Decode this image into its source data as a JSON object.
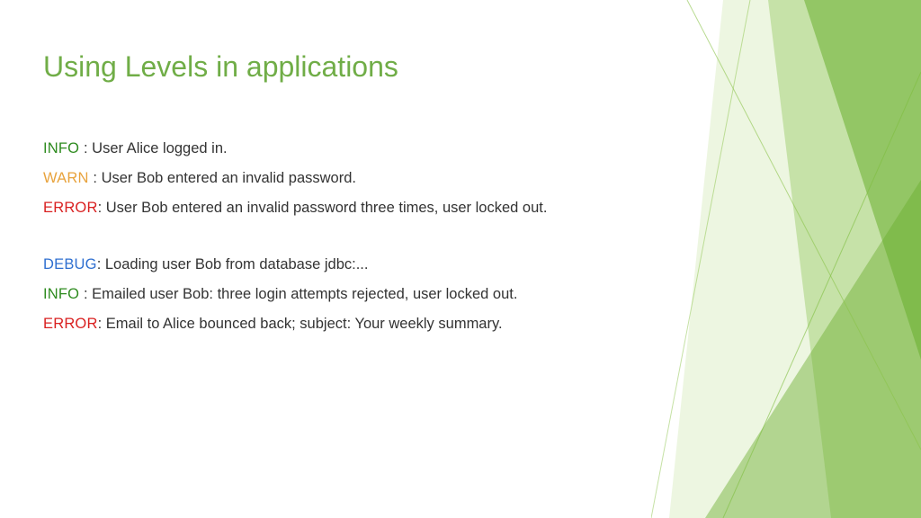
{
  "title": "Using Levels in applications",
  "logs": {
    "group1": [
      {
        "level": "INFO",
        "levelPadded": "INFO ",
        "sep": ": ",
        "msg": "User Alice logged in."
      },
      {
        "level": "WARN",
        "levelPadded": "WARN ",
        "sep": ": ",
        "msg": "User Bob entered an invalid password."
      },
      {
        "level": "ERROR",
        "levelPadded": "ERROR",
        "sep": ": ",
        "msg": "User Bob entered an invalid password three times, user locked out."
      }
    ],
    "group2": [
      {
        "level": "DEBUG",
        "levelPadded": "DEBUG",
        "sep": ": ",
        "msg": "Loading user Bob from database jdbc:..."
      },
      {
        "level": "INFO",
        "levelPadded": "INFO ",
        "sep": ": ",
        "msg": "Emailed user Bob: three login attempts rejected, user locked out."
      },
      {
        "level": "ERROR",
        "levelPadded": "ERROR",
        "sep": ": ",
        "msg": "Email to Alice bounced back; subject: Your weekly summary."
      }
    ]
  },
  "colors": {
    "title": "#70AD47",
    "INFO": "#2E8B1F",
    "WARN": "#E8A33D",
    "ERROR": "#D92121",
    "DEBUG": "#2F6FD0"
  }
}
